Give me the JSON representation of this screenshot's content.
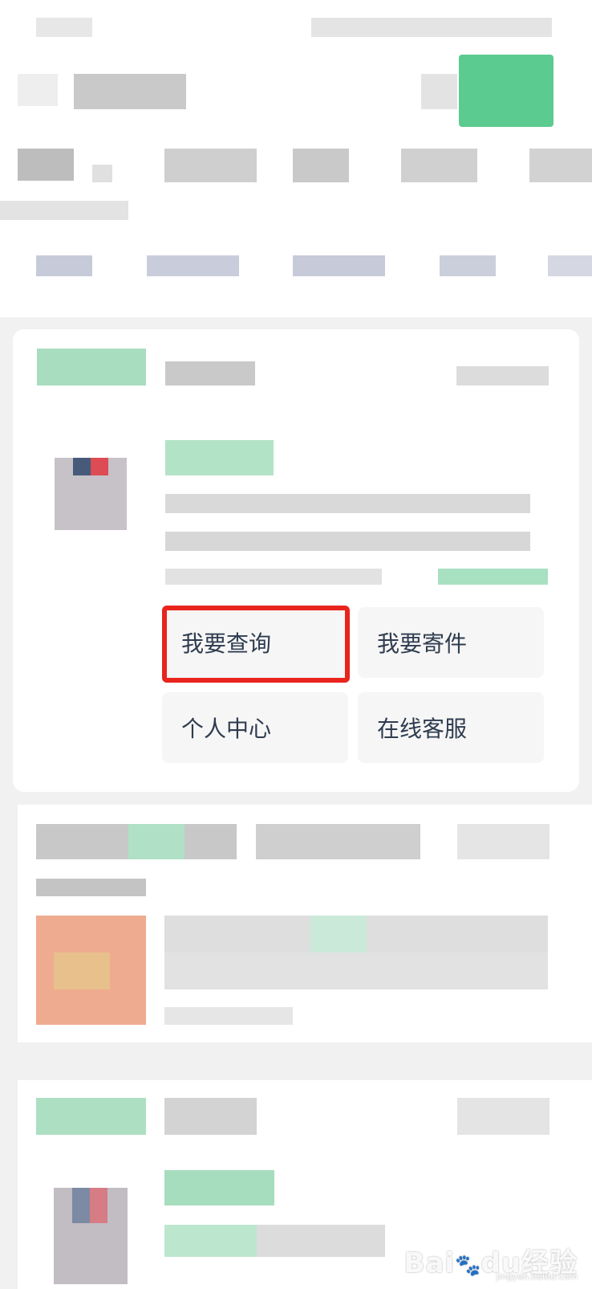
{
  "service_card": {
    "menu": [
      {
        "label": "我要查询",
        "highlighted": true
      },
      {
        "label": "我要寄件",
        "highlighted": false
      },
      {
        "label": "个人中心",
        "highlighted": false
      },
      {
        "label": "在线客服",
        "highlighted": false
      }
    ]
  },
  "watermark": {
    "brand": "Bai",
    "paw": "🐾",
    "brand_suffix": "du",
    "product": "经验",
    "url": "jingyan.baidu.com"
  },
  "colors": {
    "accent_green": "#2ecc71",
    "highlight_red": "#e9241d",
    "button_text": "#2f3c4f"
  }
}
